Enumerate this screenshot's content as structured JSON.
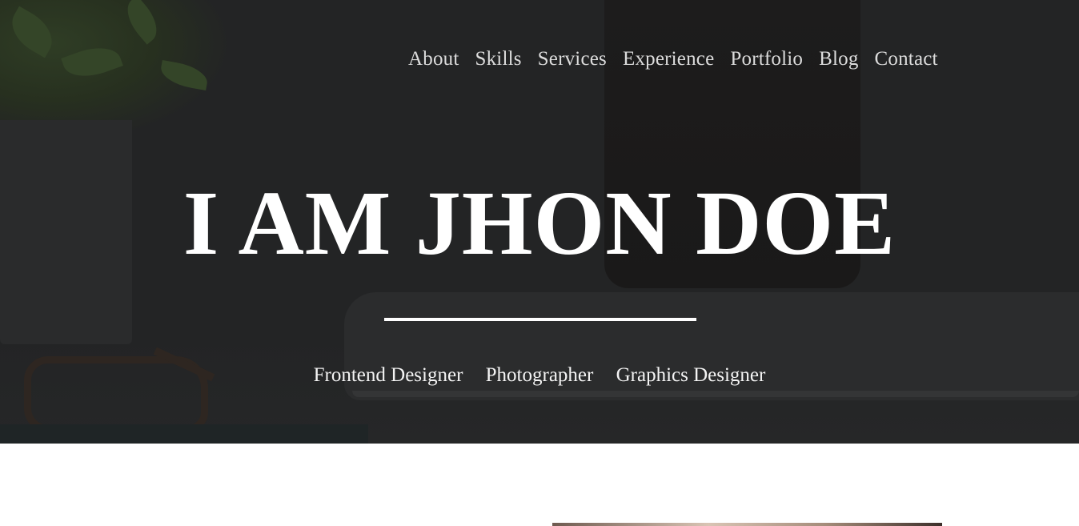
{
  "nav": {
    "items": [
      {
        "label": "About"
      },
      {
        "label": "Skills"
      },
      {
        "label": "Services"
      },
      {
        "label": "Experience"
      },
      {
        "label": "Portfolio"
      },
      {
        "label": "Blog"
      },
      {
        "label": "Contact"
      }
    ]
  },
  "hero": {
    "headline": "I AM JHON DOE",
    "roles": [
      "Frontend Designer",
      "Photographer",
      "Graphics Designer"
    ]
  },
  "colors": {
    "hero_overlay": "#232425",
    "text": "#ffffff"
  }
}
